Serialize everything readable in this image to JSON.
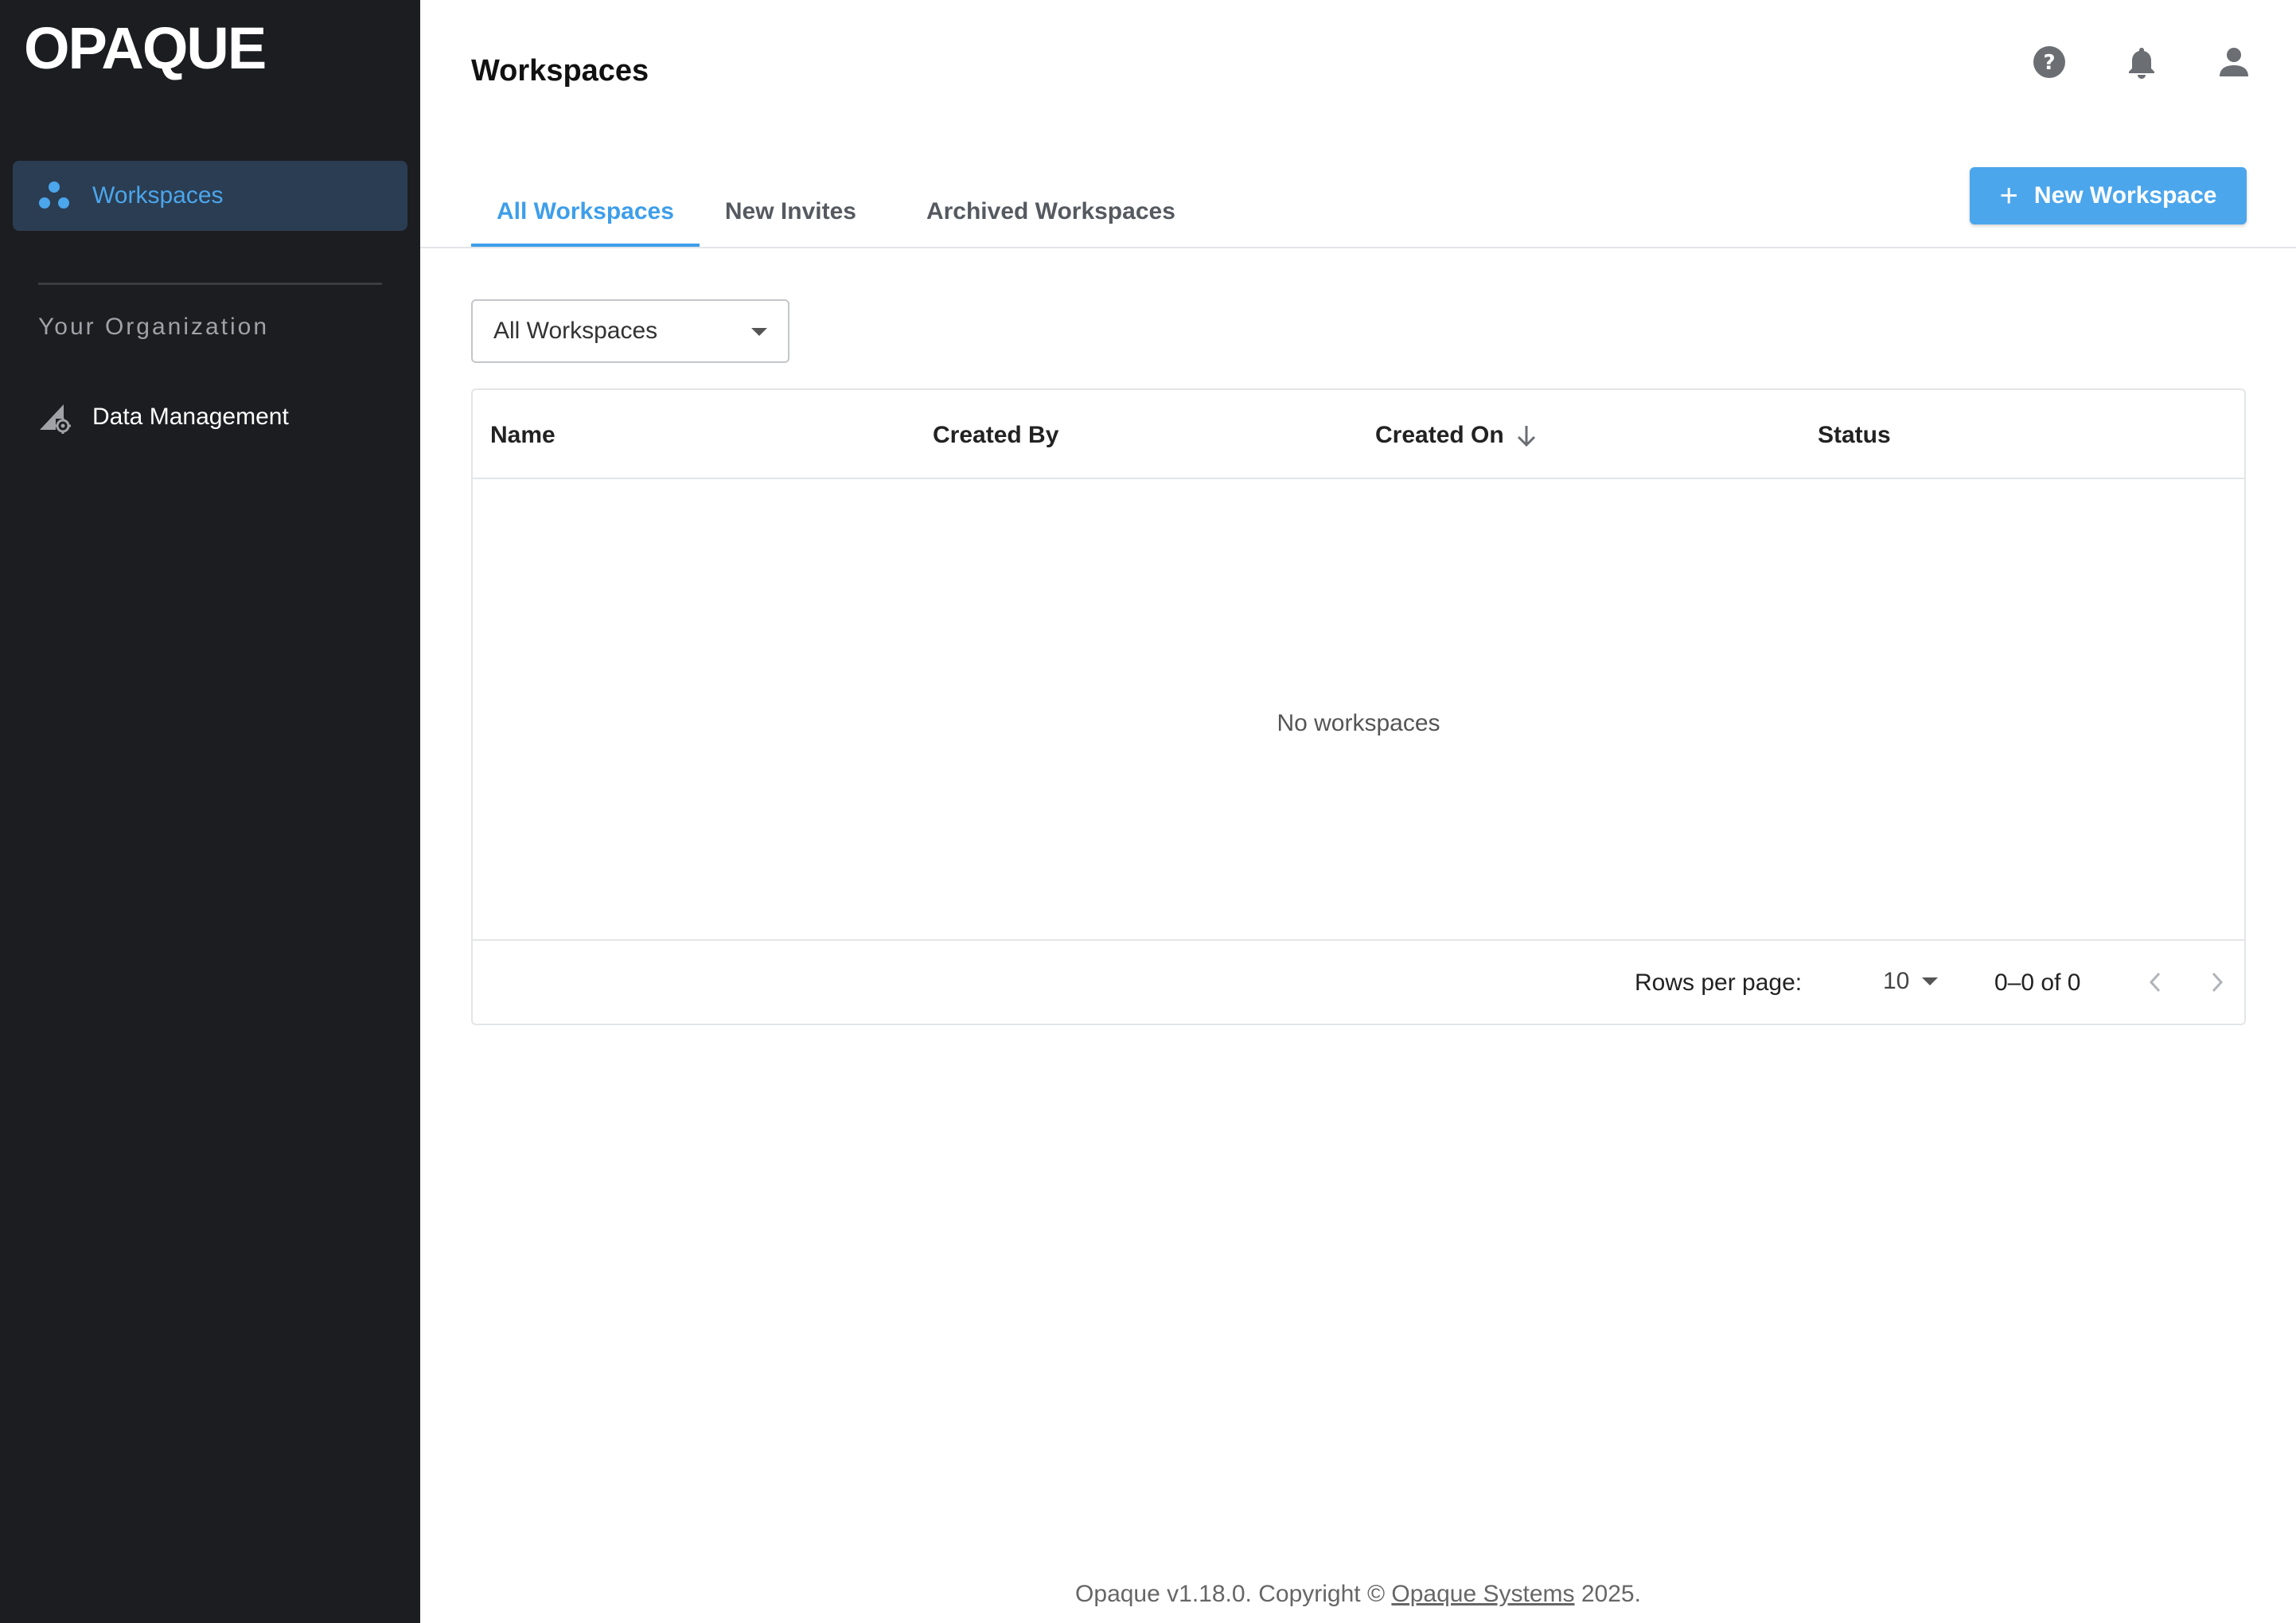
{
  "brand": {
    "logo_text": "OPAQUE"
  },
  "sidebar": {
    "items": [
      {
        "label": "Workspaces",
        "icon": "workspaces-icon",
        "active": true
      },
      {
        "label": "Data Management",
        "icon": "data-management-icon",
        "active": false
      }
    ],
    "section_title": "Your Organization"
  },
  "header": {
    "title": "Workspaces",
    "icons": [
      "help-icon",
      "notifications-icon",
      "account-icon"
    ]
  },
  "tabs": [
    {
      "label": "All Workspaces",
      "active": true
    },
    {
      "label": "New Invites",
      "active": false
    },
    {
      "label": "Archived Workspaces",
      "active": false
    }
  ],
  "toolbar": {
    "new_workspace_label": "New Workspace",
    "filter_value": "All Workspaces"
  },
  "table": {
    "columns": [
      "Name",
      "Created By",
      "Created On",
      "Status"
    ],
    "sorted_column": "Created On",
    "sort_direction": "descending",
    "empty_message": "No workspaces",
    "pagination": {
      "rows_per_page_label": "Rows per page:",
      "rows_per_page_value": "10",
      "range_text": "0–0 of 0"
    }
  },
  "footer": {
    "prefix": "Opaque v1.18.0. Copyright ©",
    "link_text": "Opaque Systems",
    "suffix": "2025."
  },
  "colors": {
    "sidebar_bg": "#1c1d21",
    "accent": "#4ba6ec",
    "active_nav_bg": "#2b3d52"
  }
}
